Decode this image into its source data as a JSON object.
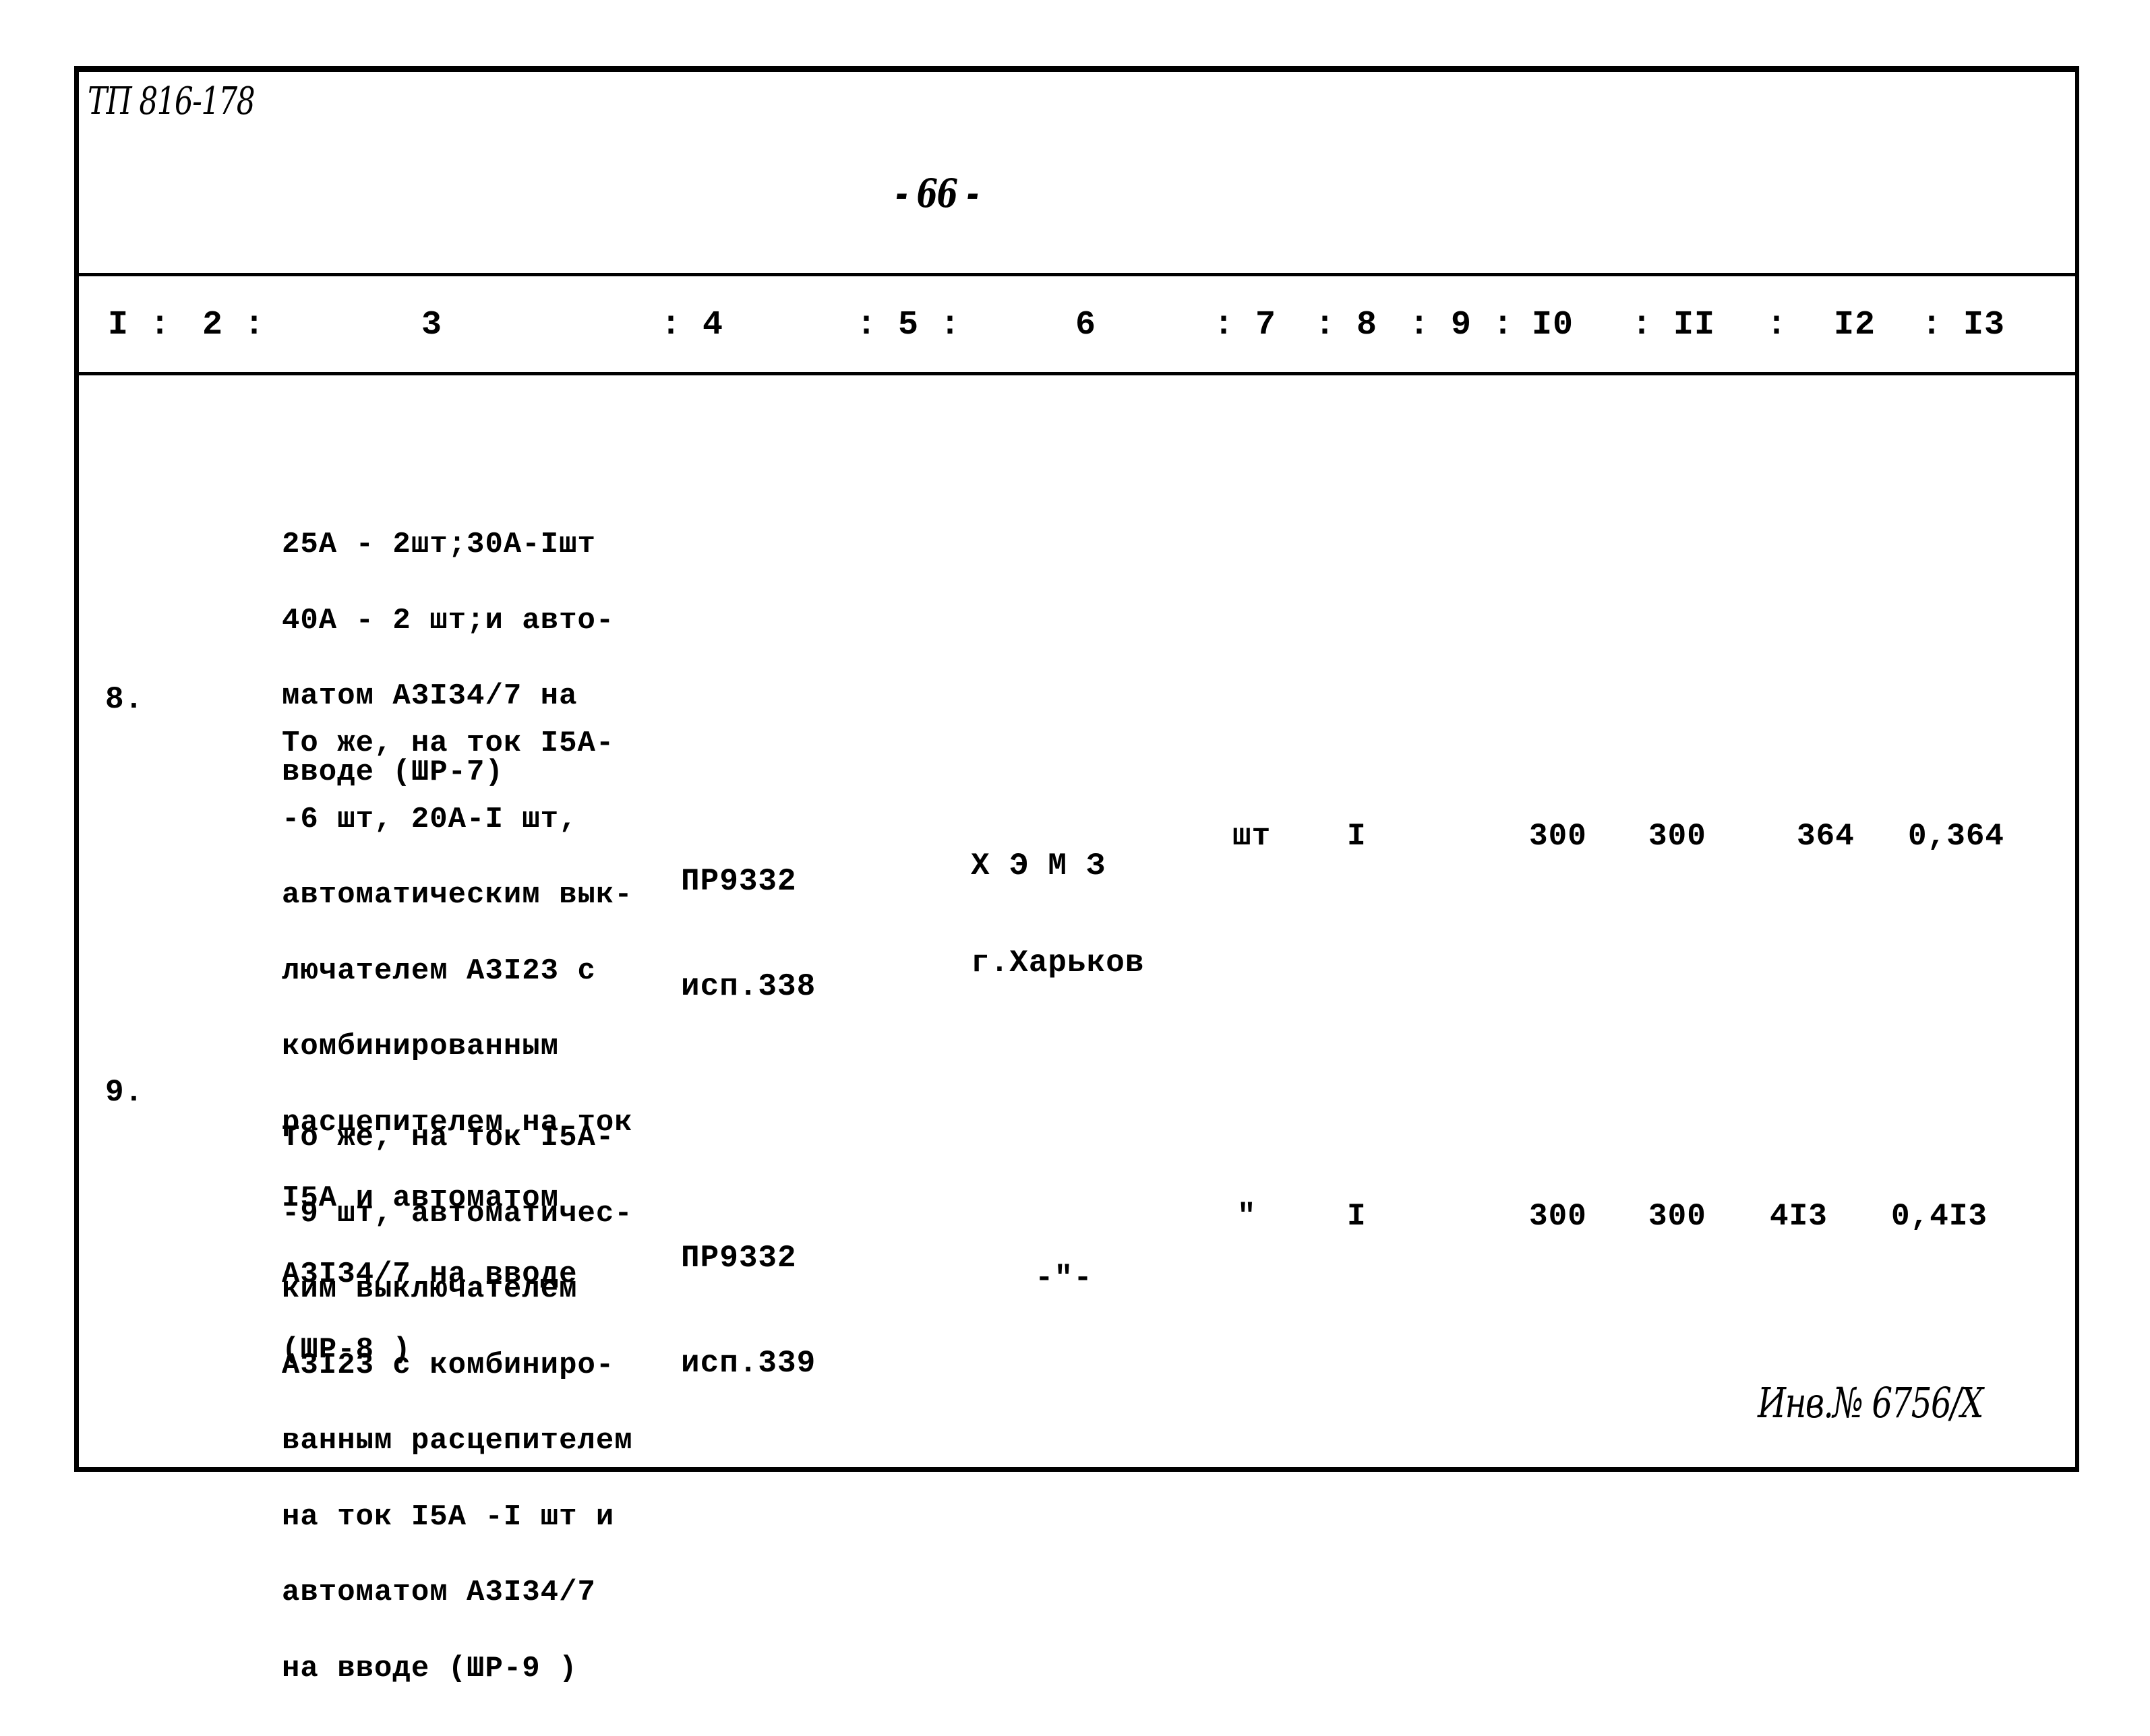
{
  "document": {
    "code": "ТП 816-178",
    "page_number": "- 66 -",
    "inventory_note": "Инв.№ 6756/X"
  },
  "table": {
    "column_headers": [
      "I :",
      "2 :",
      "3",
      ": 4",
      ": 5 :",
      "6",
      ": 7",
      ": 8",
      ": 9 :",
      "I0",
      ": II",
      ":",
      "I2",
      ": I3"
    ],
    "continuation": {
      "description_lines": [
        "25А - 2шт;30А-Iшт",
        "40А - 2 шт;и авто-",
        "матом А3I34/7 на",
        "вводе (ШР-7)"
      ]
    },
    "rows": [
      {
        "number": "8.",
        "description_lines": [
          "То же, на ток I5А-",
          "-6 шт, 20А-I шт,",
          "автоматическим вык-",
          "лючателем А3I23 с",
          "комбинированным",
          "расцепителем на ток",
          "I5А и автоматом",
          "А3I34/7 на вводе",
          "(ШР-8 )"
        ],
        "type_lines": [
          "ПР9332",
          "исп.338"
        ],
        "manufacturer_lines": [
          "Х Э М З",
          "г.Харьков"
        ],
        "unit": "шт",
        "quantity": "I",
        "col10": "300",
        "col11": "300",
        "col12": "364",
        "col13": "0,364"
      },
      {
        "number": "9.",
        "description_lines": [
          "То же, на ток I5А-",
          "-9 шт, автоматичес-",
          "ким выключателем",
          "А3I23 с комбиниро-",
          "ванным расцепителем",
          "на ток I5А -I шт и",
          "автоматом А3I34/7",
          "на вводе (ШР-9 )"
        ],
        "type_lines": [
          "ПР9332",
          "исп.339"
        ],
        "manufacturer_lines": [
          "-\"-"
        ],
        "unit": "\"",
        "quantity": "I",
        "col10": "300",
        "col11": "300",
        "col12": "4I3",
        "col13": "0,4I3"
      }
    ]
  }
}
